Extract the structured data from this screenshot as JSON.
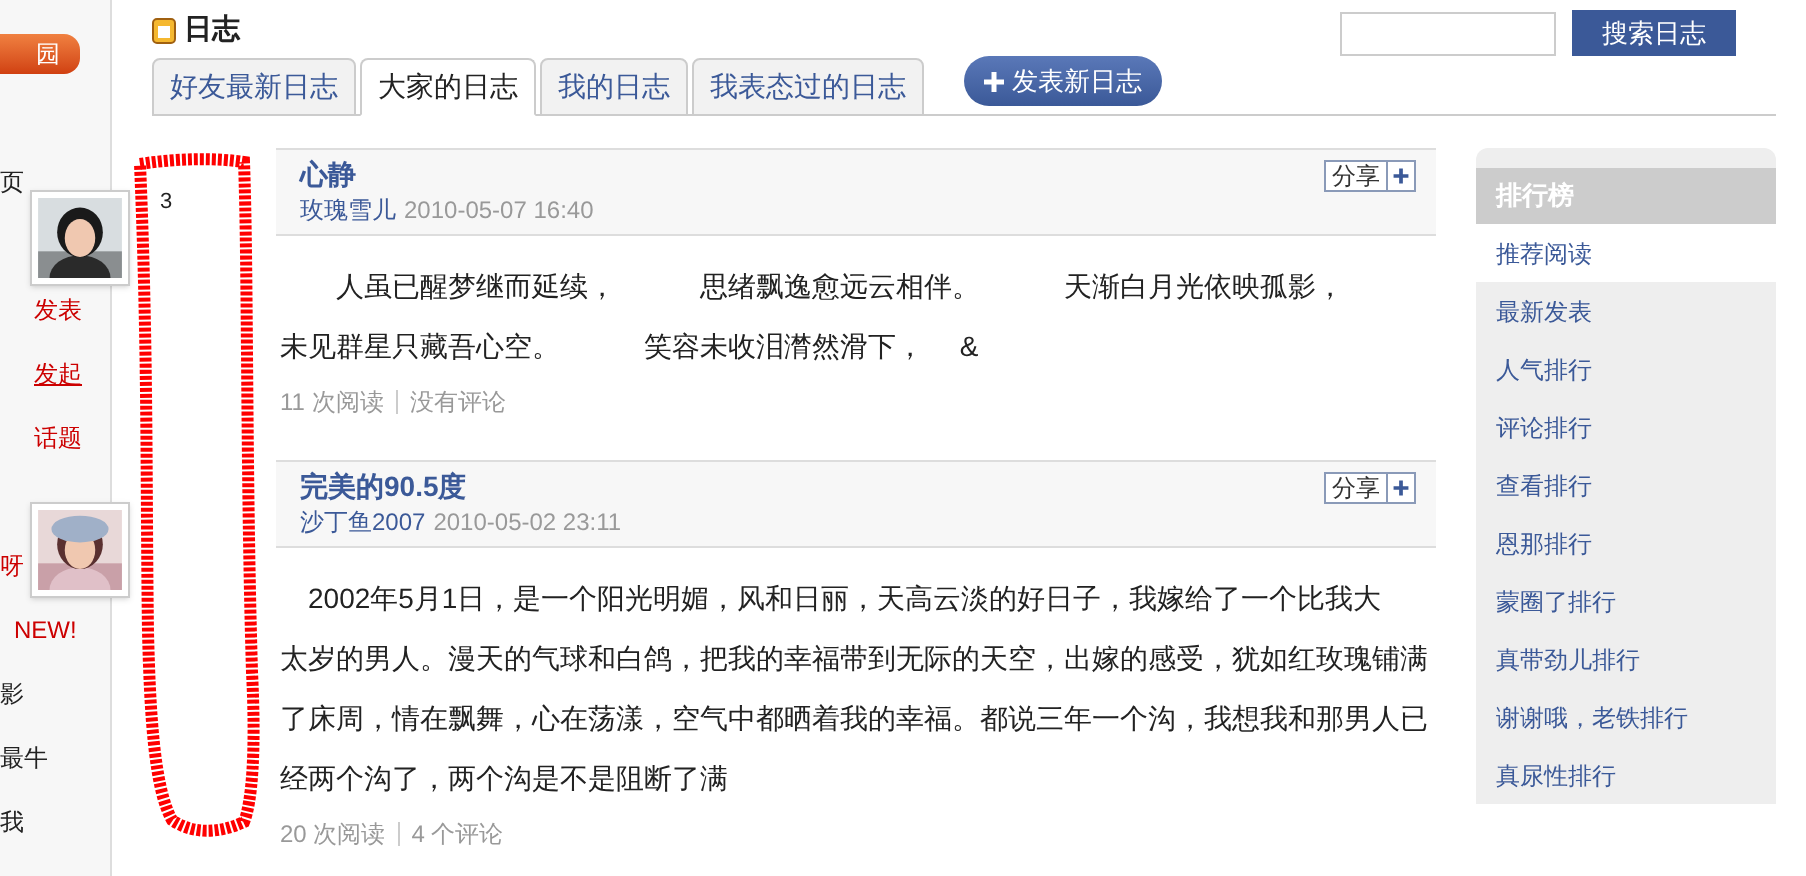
{
  "left_nav": {
    "tab": "园",
    "items": [
      {
        "label": "页",
        "kind": "edge",
        "underlined": false
      },
      {
        "label": "发表",
        "kind": "link",
        "underlined": false
      },
      {
        "label": "发起",
        "kind": "link",
        "underlined": true
      },
      {
        "label": "话题",
        "kind": "link",
        "underlined": false
      },
      {
        "label": "呀",
        "kind": "edge-link",
        "underlined": false
      },
      {
        "label": "NEW!",
        "kind": "new",
        "underlined": false
      },
      {
        "label": "影",
        "kind": "edge",
        "underlined": false
      },
      {
        "label": "最牛",
        "kind": "edge",
        "underlined": false
      },
      {
        "label": "我",
        "kind": "edge",
        "underlined": false
      }
    ]
  },
  "page": {
    "title": "日志"
  },
  "search": {
    "button": "搜索日志"
  },
  "tabs": [
    {
      "label": "好友最新日志",
      "selected": false
    },
    {
      "label": "大家的日志",
      "selected": true
    },
    {
      "label": "我的日志",
      "selected": false
    },
    {
      "label": "我表态过的日志",
      "selected": false
    }
  ],
  "new_post_button": "发表新日志",
  "stray_number": "3",
  "posts": [
    {
      "title": "心静",
      "author": "玫瑰雪儿",
      "date": "2010-05-07 16:40",
      "share": "分享",
      "body": [
        "　　人虽已醒梦继而延续，　　　思绪飘逸愈远云相伴。　　　天渐白月光依映孤影，",
        "未见群星只藏吾心空。　　　笑容未收泪潸然滑下，　 &"
      ],
      "reads": "11 次阅读",
      "comments": "没有评论"
    },
    {
      "title": "完美的90.5度",
      "author": "沙丁鱼2007",
      "date": "2010-05-02 23:11",
      "share": "分享",
      "body": [
        "　2002年5月1日，是一个阳光明媚，风和日丽，天高云淡的好日子，我嫁给了一个比我大",
        "太岁的男人。漫天的气球和白鸽，把我的幸福带到无际的天空，出嫁的感受，犹如红玫瑰铺满",
        "了床周，情在飘舞，心在荡漾，空气中都晒着我的幸福。都说三年一个沟，我想我和那男人已",
        "经两个沟了，两个沟是不是阻断了满"
      ],
      "reads": "20 次阅读",
      "comments": "4 个评论"
    }
  ],
  "ranking": {
    "title": "排行榜",
    "items": [
      {
        "label": "推荐阅读",
        "selected": true
      },
      {
        "label": "最新发表",
        "selected": false
      },
      {
        "label": "人气排行",
        "selected": false
      },
      {
        "label": "评论排行",
        "selected": false
      },
      {
        "label": "查看排行",
        "selected": false
      },
      {
        "label": "恩那排行",
        "selected": false
      },
      {
        "label": "蒙圈了排行",
        "selected": false
      },
      {
        "label": "真带劲儿排行",
        "selected": false
      },
      {
        "label": "谢谢哦，老铁排行",
        "selected": false
      },
      {
        "label": "真尿性排行",
        "selected": false
      }
    ]
  }
}
